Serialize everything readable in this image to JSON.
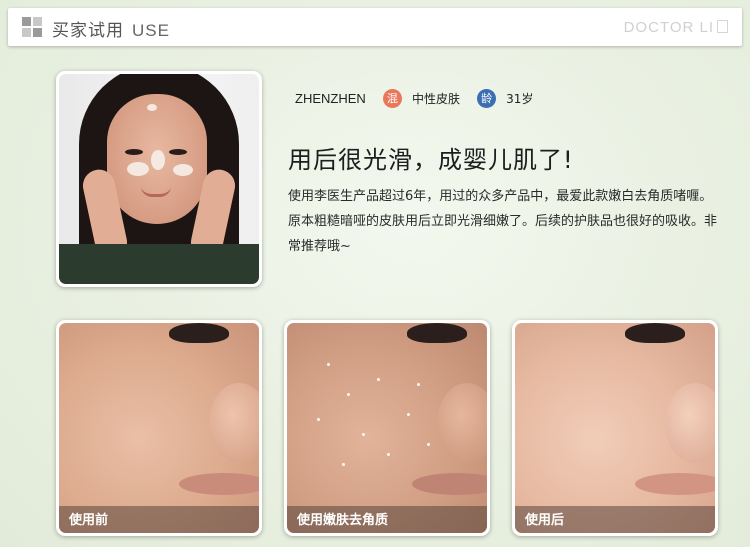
{
  "header": {
    "title_cn": "买家试用",
    "title_en": "USE",
    "brand": "DOCTOR LI"
  },
  "user": {
    "name": "ZHENZHEN",
    "skin_icon": "混",
    "skin_type": "中性皮肤",
    "age_icon": "龄",
    "age": "31岁"
  },
  "headline": "用后很光滑，成婴儿肌了!",
  "review": "使用李医生产品超过6年，用过的众多产品中，最爱此款嫩白去角质啫喱。原本粗糙暗哑的皮肤用后立即光滑细嫩了。后续的护肤品也很好的吸收。非常推荐哦~",
  "photos": [
    {
      "caption": "使用前"
    },
    {
      "caption": "使用嫩肤去角质"
    },
    {
      "caption": "使用后"
    }
  ],
  "colors": {
    "skin_tag": "#e9775c",
    "age_tag": "#3b6fb3"
  }
}
